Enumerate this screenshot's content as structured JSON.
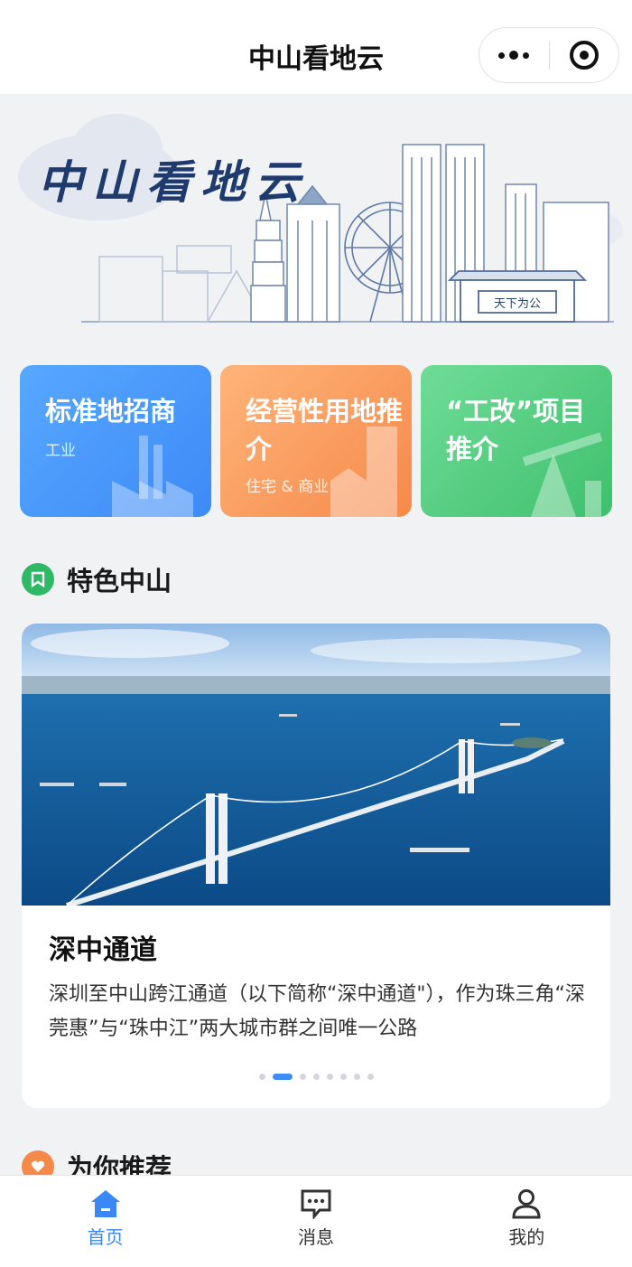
{
  "header": {
    "title": "中山看地云",
    "more_icon": "more-dots-icon",
    "close_icon": "target-close-icon"
  },
  "banner": {
    "logo_text": "中山看地云",
    "plaque_text": "天下为公"
  },
  "categories": [
    {
      "title": "标准地招商",
      "subtitle": "工业",
      "color": "#3d8af7"
    },
    {
      "title": "经营性用地推介",
      "subtitle": "住宅 & 商业",
      "color": "#f5894a"
    },
    {
      "title": "“工改”项目推介",
      "subtitle": "",
      "color": "#3fc06d"
    }
  ],
  "section_featured": {
    "title": "特色中山",
    "icon": "bookmark-icon",
    "icon_color": "#2fb866"
  },
  "featured": {
    "title": "深中通道",
    "description": "深圳至中山跨江通道（以下简称“深中通道\"），作为珠三角“深莞惠”与“珠中江”两大城市群之间唯一公路",
    "slide_count": 8,
    "active_slide": 2
  },
  "section_recommend": {
    "title": "为你推荐",
    "icon": "heart-icon",
    "icon_color": "#f5894a"
  },
  "tabbar": {
    "items": [
      {
        "label": "首页",
        "icon": "home-icon",
        "active": true
      },
      {
        "label": "消息",
        "icon": "message-icon",
        "active": false
      },
      {
        "label": "我的",
        "icon": "profile-icon",
        "active": false
      }
    ],
    "active_color": "#3b87f5"
  }
}
